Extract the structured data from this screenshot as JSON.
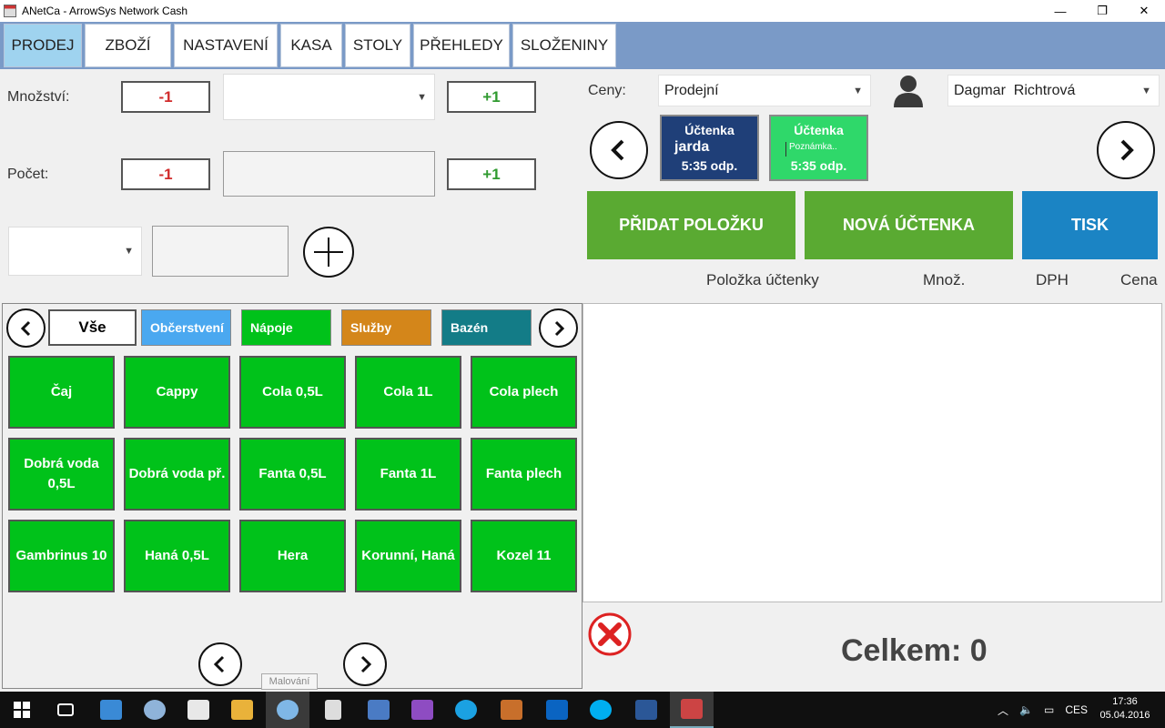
{
  "window": {
    "title": "ANetCa - ArrowSys Network Cash",
    "minimize": "—",
    "restore": "❐",
    "close": "✕"
  },
  "tabs": [
    "PRODEJ",
    "ZBOŽÍ",
    "NASTAVENÍ",
    "KASA",
    "STOLY",
    "PŘEHLEDY",
    "SLOŽENINY"
  ],
  "form": {
    "mnozstvi_label": "Množství:",
    "pocet_label": "Počet:",
    "minus": "-1",
    "plus": "+1"
  },
  "prices": {
    "label": "Ceny:",
    "selected": "Prodejní"
  },
  "user": {
    "name": "Dagmar  Richtrová"
  },
  "receipts": [
    {
      "title": "Účtenka",
      "name": "jarda",
      "note": "",
      "time": "5:35 odp.",
      "color": "#1f3f78"
    },
    {
      "title": "Účtenka",
      "name": "",
      "note": "Poznámka..",
      "time": "5:35 odp.",
      "color": "#2fd86a"
    }
  ],
  "actions": {
    "add_item": "PŘIDAT POLOŽKU",
    "new_receipt": "NOVÁ ÚČTENKA",
    "print": "TISK"
  },
  "columns": {
    "item": "Položka účtenky",
    "qty": "Množ.",
    "vat": "DPH",
    "price": "Cena"
  },
  "categories": [
    {
      "label": "Vše",
      "bg": "#ffffff",
      "fg": "#000000"
    },
    {
      "label": "Občerstvení",
      "bg": "#4aa8f0",
      "fg": "#ffffff"
    },
    {
      "label": "Nápoje",
      "bg": "#00c21a",
      "fg": "#ffffff"
    },
    {
      "label": "Služby",
      "bg": "#d4861a",
      "fg": "#ffffff"
    },
    {
      "label": "Bazén",
      "bg": "#137c87",
      "fg": "#ffffff"
    }
  ],
  "products": [
    [
      "Čaj",
      "Cappy",
      "Cola 0,5L",
      "Cola 1L",
      "Cola plech"
    ],
    [
      "Dobrá voda 0,5L",
      "Dobrá voda př.",
      "Fanta 0,5L",
      "Fanta 1L",
      "Fanta plech"
    ],
    [
      "Gambrinus 10",
      "Haná 0,5L",
      "Hera",
      "Korunní, Haná",
      "Kozel 11"
    ]
  ],
  "total": {
    "text": "Celkem: 0"
  },
  "tooltip": "Malování",
  "taskbar": {
    "lang": "CES",
    "time": "17:36",
    "date": "05.04.2016",
    "icons": [
      "task-view-icon",
      "remote-desktop-icon",
      "network-icon",
      "store-icon",
      "file-explorer-icon",
      "paint-icon",
      "calculator-icon",
      "computer-icon",
      "visual-studio-icon",
      "internet-explorer-icon",
      "media-icon",
      "outlook-icon",
      "skype-icon",
      "word-icon",
      "anetca-icon"
    ]
  }
}
